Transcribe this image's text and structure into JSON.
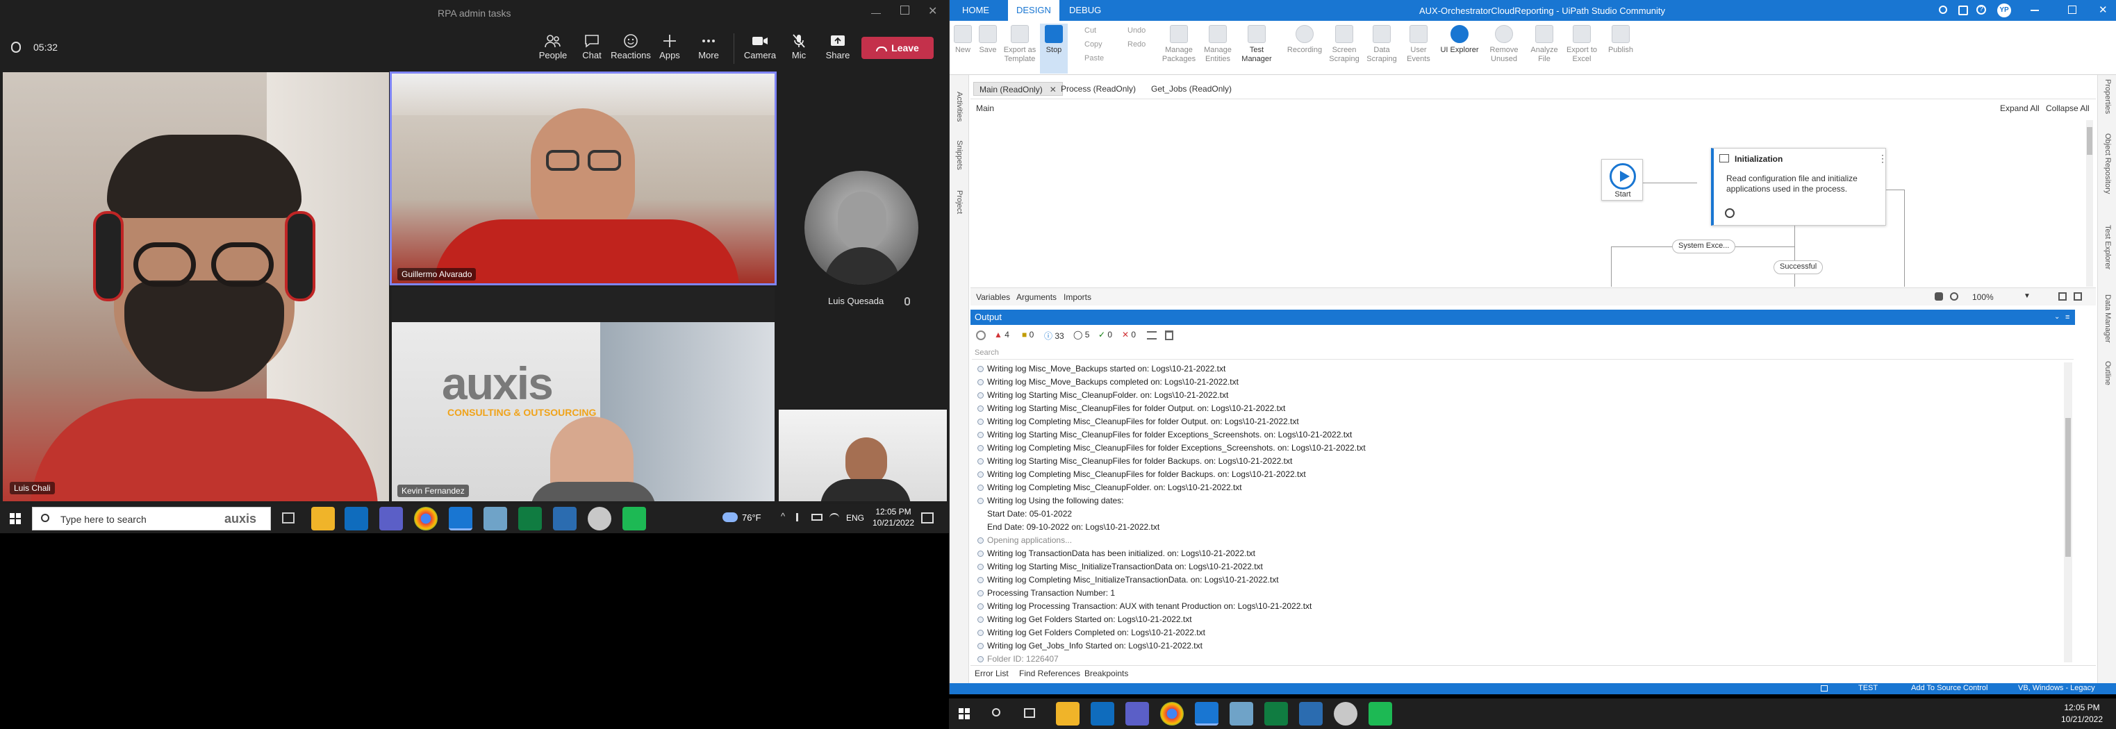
{
  "teams": {
    "window_title": "RPA admin tasks",
    "timer": "05:32",
    "toolbar": [
      {
        "label": "People",
        "icon": "people-icon"
      },
      {
        "label": "Chat",
        "icon": "chat-icon"
      },
      {
        "label": "Reactions",
        "icon": "reactions-icon"
      },
      {
        "label": "Apps",
        "icon": "apps-icon"
      },
      {
        "label": "More",
        "icon": "more-icon"
      },
      {
        "label": "Camera",
        "icon": "camera-icon"
      },
      {
        "label": "Mic",
        "icon": "mic-off-icon"
      },
      {
        "label": "Share",
        "icon": "share-icon"
      }
    ],
    "leave_label": "Leave",
    "participants": {
      "p1": "Luis Chali",
      "p2": "Guillermo Alvarado",
      "p3": "Luis Quesada",
      "p4": "Kevin Fernandez"
    },
    "wall_logo": "auxis",
    "wall_tagline": "CONSULTING & OUTSOURCING"
  },
  "left_taskbar": {
    "search_placeholder": "Type here to search",
    "search_logo": "auxis",
    "temperature": "76°F",
    "language": "ENG",
    "time": "12:05 PM",
    "date": "10/21/2022"
  },
  "uipath": {
    "title": "AUX-OrchestratorCloudReporting - UiPath Studio Community",
    "user_initials": "YP",
    "tabs": [
      "HOME",
      "DESIGN",
      "DEBUG"
    ],
    "ribbon": [
      {
        "label": "New"
      },
      {
        "label": "Save"
      },
      {
        "label": "Export as Template"
      },
      {
        "label": "Stop"
      },
      {
        "label": "Manage Packages"
      },
      {
        "label": "Manage Entities"
      },
      {
        "label": "Test Manager"
      },
      {
        "label": "Recording"
      },
      {
        "label": "Screen Scraping"
      },
      {
        "label": "Data Scraping"
      },
      {
        "label": "User Events"
      },
      {
        "label": "UI Explorer"
      },
      {
        "label": "Remove Unused"
      },
      {
        "label": "Analyze File"
      },
      {
        "label": "Export to Excel"
      },
      {
        "label": "Publish"
      }
    ],
    "clipboard": {
      "cut": "Cut",
      "copy": "Copy",
      "paste": "Paste",
      "undo": "Undo",
      "redo": "Redo"
    },
    "doc_tabs": [
      "Main (ReadOnly)",
      "Process (ReadOnly)",
      "Get_Jobs (ReadOnly)"
    ],
    "breadcrumb": "Main",
    "expand_all": "Expand All",
    "collapse_all": "Collapse All",
    "left_panels": [
      "Activities",
      "Snippets",
      "Project"
    ],
    "right_panels": [
      "Properties",
      "Object Repository",
      "Test Explorer",
      "Data Manager",
      "Outline"
    ],
    "workflow": {
      "start": "Start",
      "init_title": "Initialization",
      "init_desc": "Read configuration file and initialize applications used in the process.",
      "sys_exc": "System Exce...",
      "successful": "Successful"
    },
    "designer_tabs": [
      "Variables",
      "Arguments",
      "Imports"
    ],
    "zoom": "100%",
    "output": {
      "title": "Output",
      "counts": {
        "error": "4",
        "warning": "0",
        "info": "33",
        "trace": "5",
        "ok": "0",
        "fail": "0"
      },
      "search_placeholder": "Search",
      "lines": [
        {
          "text": "Writing log Misc_Move_Backups started on: Logs\\10-21-2022.txt",
          "bullet": true
        },
        {
          "text": "Writing log Misc_Move_Backups completed on: Logs\\10-21-2022.txt",
          "bullet": true
        },
        {
          "text": "Writing log Starting Misc_CleanupFolder. on: Logs\\10-21-2022.txt",
          "bullet": true
        },
        {
          "text": "Writing log Starting Misc_CleanupFiles for folder Output. on: Logs\\10-21-2022.txt",
          "bullet": true
        },
        {
          "text": "Writing log Completing Misc_CleanupFiles for folder Output. on: Logs\\10-21-2022.txt",
          "bullet": true
        },
        {
          "text": "Writing log Starting Misc_CleanupFiles for folder Exceptions_Screenshots. on: Logs\\10-21-2022.txt",
          "bullet": true
        },
        {
          "text": "Writing log Completing Misc_CleanupFiles for folder Exceptions_Screenshots. on: Logs\\10-21-2022.txt",
          "bullet": true
        },
        {
          "text": "Writing log Starting Misc_CleanupFiles for folder Backups. on: Logs\\10-21-2022.txt",
          "bullet": true
        },
        {
          "text": "Writing log Completing Misc_CleanupFiles for folder Backups. on: Logs\\10-21-2022.txt",
          "bullet": true
        },
        {
          "text": "Writing log Completing Misc_CleanupFolder. on: Logs\\10-21-2022.txt",
          "bullet": true
        },
        {
          "text": "Writing log Using the following dates:",
          "bullet": true
        },
        {
          "text": "Start Date: 05-01-2022",
          "bullet": false
        },
        {
          "text": "End Date: 09-10-2022 on: Logs\\10-21-2022.txt",
          "bullet": false
        },
        {
          "text": "Opening applications...",
          "bullet": true,
          "muted": true
        },
        {
          "text": "Writing log TransactionData has been initialized. on: Logs\\10-21-2022.txt",
          "bullet": true
        },
        {
          "text": "Writing log Starting Misc_InitializeTransactionData on: Logs\\10-21-2022.txt",
          "bullet": true
        },
        {
          "text": "Writing log Completing Misc_InitializeTransactionData. on: Logs\\10-21-2022.txt",
          "bullet": true
        },
        {
          "text": "Processing Transaction Number: 1",
          "bullet": true
        },
        {
          "text": "Writing log Processing Transaction: AUX with tenant Production on: Logs\\10-21-2022.txt",
          "bullet": true
        },
        {
          "text": "Writing log Get Folders Started on: Logs\\10-21-2022.txt",
          "bullet": true
        },
        {
          "text": "Writing log Get Folders Completed on: Logs\\10-21-2022.txt",
          "bullet": true
        },
        {
          "text": "Writing log Get_Jobs_Info Started on: Logs\\10-21-2022.txt",
          "bullet": true
        },
        {
          "text": "Folder ID: 1226407",
          "bullet": true,
          "muted": true
        }
      ]
    },
    "bottom_tabs": [
      "Error List",
      "Find References",
      "Breakpoints"
    ],
    "status": {
      "test": "TEST",
      "source_control": "Add To Source Control",
      "env": "VB, Windows - Legacy"
    }
  },
  "right_taskbar": {
    "time": "12:05 PM",
    "date": "10/21/2022"
  },
  "colors": {
    "uipath_blue": "#1976d2",
    "teams_bg": "#1f1f1f",
    "leave_red": "#c4314b",
    "tile_border": "#7f85f5"
  }
}
